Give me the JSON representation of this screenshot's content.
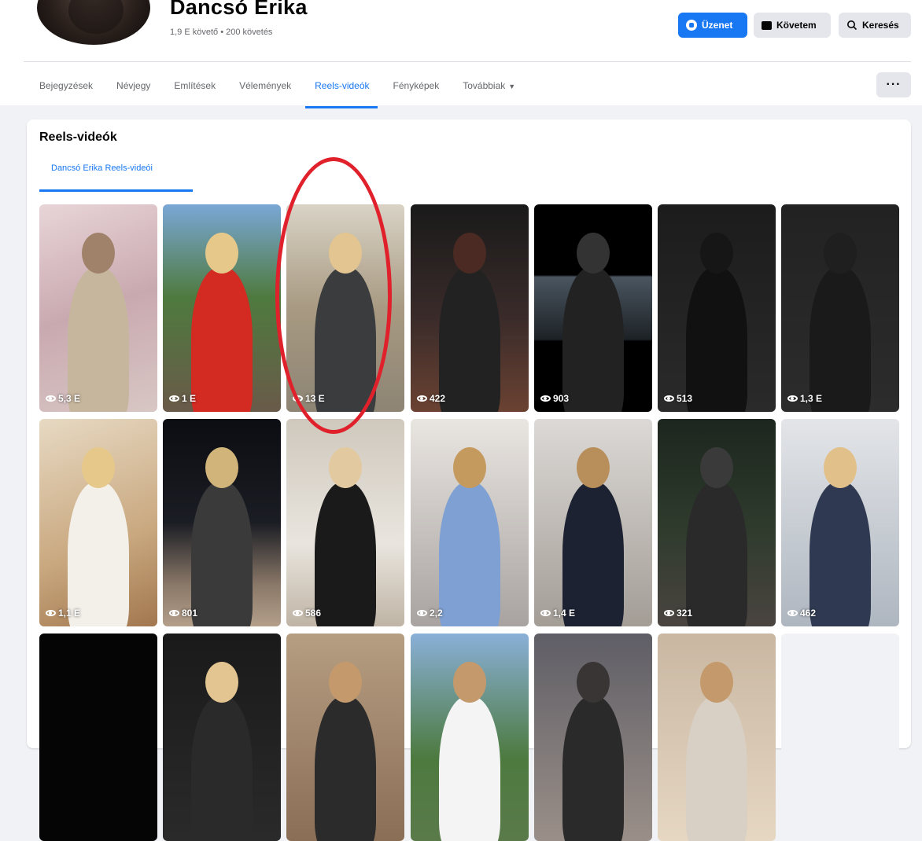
{
  "profile": {
    "name": "Dancsó Erika",
    "meta": "1,9 E követő • 200 követés"
  },
  "header_buttons": {
    "message": "Üzenet",
    "follow": "Követem",
    "search": "Keresés"
  },
  "tabs": [
    {
      "label": "Bejegyzések"
    },
    {
      "label": "Névjegy"
    },
    {
      "label": "Említések"
    },
    {
      "label": "Vélemények"
    },
    {
      "label": "Reels-videók",
      "active": true
    },
    {
      "label": "Fényképek"
    },
    {
      "label": "Továbbiak"
    }
  ],
  "more_label": "···",
  "section": {
    "title": "Reels-videók",
    "subtab": "Dancsó Erika Reels-videói"
  },
  "reels": [
    {
      "views": "5,3 E"
    },
    {
      "views": "1 E"
    },
    {
      "views": "13 E"
    },
    {
      "views": "422"
    },
    {
      "views": "903"
    },
    {
      "views": "513"
    },
    {
      "views": "1,3 E"
    },
    {
      "views": "1,1 E"
    },
    {
      "views": "801"
    },
    {
      "views": "586"
    },
    {
      "views": "2,2"
    },
    {
      "views": "1,4 E"
    },
    {
      "views": "321"
    },
    {
      "views": "462"
    },
    {
      "views": ""
    },
    {
      "views": ""
    },
    {
      "views": ""
    },
    {
      "views": ""
    },
    {
      "views": ""
    },
    {
      "views": ""
    }
  ],
  "colors": {
    "accent": "#1877f2",
    "highlight": "#e0202b"
  }
}
